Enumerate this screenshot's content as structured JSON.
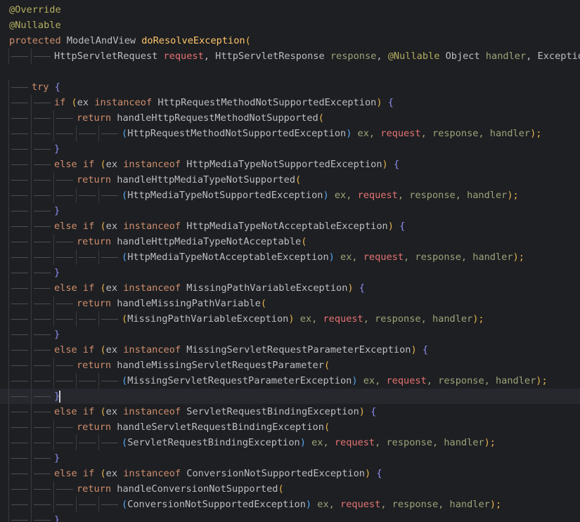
{
  "colors": {
    "background": "#1e1f22",
    "current_line": "#26282e",
    "annotation": "#b3ae60",
    "keyword": "#cf8e6d",
    "method_declaration": "#ffc66d",
    "type": "#bcbec4"
  },
  "editor": {
    "lines": [
      {
        "indent": 0,
        "tokens": [
          {
            "t": "@Override",
            "c": "t-ann"
          }
        ]
      },
      {
        "indent": 0,
        "tokens": [
          {
            "t": "@Nullable",
            "c": "t-ann"
          }
        ]
      },
      {
        "indent": 0,
        "tokens": [
          {
            "t": "protected",
            "c": "t-kw"
          },
          {
            "t": " ModelAndView ",
            "c": "t-ty"
          },
          {
            "t": "doResolveException",
            "c": "t-fnd"
          },
          {
            "t": "(",
            "c": "t-brace1"
          }
        ]
      },
      {
        "indent": 2,
        "tokens": [
          {
            "t": "HttpServletRequest ",
            "c": "t-ty"
          },
          {
            "t": "request",
            "c": "t-argp"
          },
          {
            "t": ", ",
            "c": "t-punc"
          },
          {
            "t": "HttpServletResponse ",
            "c": "t-ty"
          },
          {
            "t": "response",
            "c": "t-argr"
          },
          {
            "t": ", ",
            "c": "t-punc"
          },
          {
            "t": "@Nullable",
            "c": "t-ann"
          },
          {
            "t": " Object ",
            "c": "t-ty"
          },
          {
            "t": "handler",
            "c": "t-argr"
          },
          {
            "t": ", ",
            "c": "t-punc"
          },
          {
            "t": "Exception ex",
            "c": "t-ty"
          }
        ]
      },
      {
        "indent": 0,
        "tokens": []
      },
      {
        "indent": 1,
        "tokens": [
          {
            "t": "try",
            "c": "t-kw"
          },
          {
            "t": " {",
            "c": "t-brace2"
          }
        ]
      },
      {
        "indent": 2,
        "tokens": [
          {
            "t": "if",
            "c": "t-kw"
          },
          {
            "t": " (",
            "c": "t-brace1"
          },
          {
            "t": "ex ",
            "c": "t-local"
          },
          {
            "t": "instanceof",
            "c": "t-kw"
          },
          {
            "t": " HttpRequestMethodNotSupportedException",
            "c": "t-ty"
          },
          {
            "t": ")",
            "c": "t-brace1"
          },
          {
            "t": " {",
            "c": "t-brace2"
          }
        ]
      },
      {
        "indent": 3,
        "tokens": [
          {
            "t": "return",
            "c": "t-kw"
          },
          {
            "t": " handleHttpRequestMethodNotSupported",
            "c": "t-ty"
          },
          {
            "t": "(",
            "c": "t-brace1"
          }
        ]
      },
      {
        "indent": 5,
        "tokens": [
          {
            "t": "(",
            "c": "t-brace3"
          },
          {
            "t": "HttpRequestMethodNotSupportedException",
            "c": "t-ty"
          },
          {
            "t": ")",
            "c": "t-brace3"
          },
          {
            "t": " ex, ",
            "c": "t-argr"
          },
          {
            "t": "request",
            "c": "t-argp"
          },
          {
            "t": ", response, handler",
            "c": "t-argr"
          },
          {
            "t": ");",
            "c": "t-brace1"
          }
        ]
      },
      {
        "indent": 2,
        "tokens": [
          {
            "t": "}",
            "c": "t-brace2"
          }
        ]
      },
      {
        "indent": 2,
        "tokens": [
          {
            "t": "else if",
            "c": "t-kw"
          },
          {
            "t": " (",
            "c": "t-brace1"
          },
          {
            "t": "ex ",
            "c": "t-local"
          },
          {
            "t": "instanceof",
            "c": "t-kw"
          },
          {
            "t": " HttpMediaTypeNotSupportedException",
            "c": "t-ty"
          },
          {
            "t": ")",
            "c": "t-brace1"
          },
          {
            "t": " {",
            "c": "t-brace2"
          }
        ]
      },
      {
        "indent": 3,
        "tokens": [
          {
            "t": "return",
            "c": "t-kw"
          },
          {
            "t": " handleHttpMediaTypeNotSupported",
            "c": "t-ty"
          },
          {
            "t": "(",
            "c": "t-brace1"
          }
        ]
      },
      {
        "indent": 5,
        "tokens": [
          {
            "t": "(",
            "c": "t-brace3"
          },
          {
            "t": "HttpMediaTypeNotSupportedException",
            "c": "t-ty"
          },
          {
            "t": ")",
            "c": "t-brace3"
          },
          {
            "t": " ex, ",
            "c": "t-argr"
          },
          {
            "t": "request",
            "c": "t-argp"
          },
          {
            "t": ", response, handler",
            "c": "t-argr"
          },
          {
            "t": ");",
            "c": "t-brace1"
          }
        ]
      },
      {
        "indent": 2,
        "tokens": [
          {
            "t": "}",
            "c": "t-brace2"
          }
        ]
      },
      {
        "indent": 2,
        "tokens": [
          {
            "t": "else if",
            "c": "t-kw"
          },
          {
            "t": " (",
            "c": "t-brace1"
          },
          {
            "t": "ex ",
            "c": "t-local"
          },
          {
            "t": "instanceof",
            "c": "t-kw"
          },
          {
            "t": " HttpMediaTypeNotAcceptableException",
            "c": "t-ty"
          },
          {
            "t": ")",
            "c": "t-brace1"
          },
          {
            "t": " {",
            "c": "t-brace2"
          }
        ]
      },
      {
        "indent": 3,
        "tokens": [
          {
            "t": "return",
            "c": "t-kw"
          },
          {
            "t": " handleHttpMediaTypeNotAcceptable",
            "c": "t-ty"
          },
          {
            "t": "(",
            "c": "t-brace1"
          }
        ]
      },
      {
        "indent": 5,
        "tokens": [
          {
            "t": "(",
            "c": "t-brace3"
          },
          {
            "t": "HttpMediaTypeNotAcceptableException",
            "c": "t-ty"
          },
          {
            "t": ")",
            "c": "t-brace3"
          },
          {
            "t": " ex, ",
            "c": "t-argr"
          },
          {
            "t": "request",
            "c": "t-argp"
          },
          {
            "t": ", response, handler",
            "c": "t-argr"
          },
          {
            "t": ");",
            "c": "t-brace1"
          }
        ]
      },
      {
        "indent": 2,
        "tokens": [
          {
            "t": "}",
            "c": "t-brace2"
          }
        ]
      },
      {
        "indent": 2,
        "tokens": [
          {
            "t": "else if",
            "c": "t-kw"
          },
          {
            "t": " (",
            "c": "t-brace1"
          },
          {
            "t": "ex ",
            "c": "t-local"
          },
          {
            "t": "instanceof",
            "c": "t-kw"
          },
          {
            "t": " MissingPathVariableException",
            "c": "t-ty"
          },
          {
            "t": ")",
            "c": "t-brace1"
          },
          {
            "t": " {",
            "c": "t-brace2"
          }
        ]
      },
      {
        "indent": 3,
        "tokens": [
          {
            "t": "return",
            "c": "t-kw"
          },
          {
            "t": " handleMissingPathVariable",
            "c": "t-ty"
          },
          {
            "t": "(",
            "c": "t-brace1"
          }
        ]
      },
      {
        "indent": 5,
        "tokens": [
          {
            "t": "(",
            "c": "t-brace1"
          },
          {
            "t": "MissingPathVariableException",
            "c": "t-ty"
          },
          {
            "t": ")",
            "c": "t-brace1"
          },
          {
            "t": " ex, ",
            "c": "t-argr"
          },
          {
            "t": "request",
            "c": "t-argp"
          },
          {
            "t": ", response, handler",
            "c": "t-argr"
          },
          {
            "t": ");",
            "c": "t-brace1"
          }
        ]
      },
      {
        "indent": 2,
        "tokens": [
          {
            "t": "}",
            "c": "t-brace2"
          }
        ]
      },
      {
        "indent": 2,
        "tokens": [
          {
            "t": "else if",
            "c": "t-kw"
          },
          {
            "t": " (",
            "c": "t-brace1"
          },
          {
            "t": "ex ",
            "c": "t-local"
          },
          {
            "t": "instanceof",
            "c": "t-kw"
          },
          {
            "t": " MissingServletRequestParameterException",
            "c": "t-ty"
          },
          {
            "t": ")",
            "c": "t-brace1"
          },
          {
            "t": " {",
            "c": "t-brace2"
          }
        ]
      },
      {
        "indent": 3,
        "tokens": [
          {
            "t": "return",
            "c": "t-kw"
          },
          {
            "t": " handleMissingServletRequestParameter",
            "c": "t-ty"
          },
          {
            "t": "(",
            "c": "t-brace1"
          }
        ]
      },
      {
        "indent": 5,
        "tokens": [
          {
            "t": "(",
            "c": "t-brace3"
          },
          {
            "t": "MissingServletRequestParameterException",
            "c": "t-ty"
          },
          {
            "t": ")",
            "c": "t-brace3"
          },
          {
            "t": " ex, ",
            "c": "t-argr"
          },
          {
            "t": "request",
            "c": "t-argp"
          },
          {
            "t": ", response, handler",
            "c": "t-argr"
          },
          {
            "t": ");",
            "c": "t-brace1"
          }
        ]
      },
      {
        "indent": 2,
        "current": true,
        "tokens": [
          {
            "t": "}",
            "c": "t-brace2"
          }
        ]
      },
      {
        "indent": 2,
        "tokens": [
          {
            "t": "else if",
            "c": "t-kw"
          },
          {
            "t": " (",
            "c": "t-brace1"
          },
          {
            "t": "ex ",
            "c": "t-local"
          },
          {
            "t": "instanceof",
            "c": "t-kw"
          },
          {
            "t": " ServletRequestBindingException",
            "c": "t-ty"
          },
          {
            "t": ")",
            "c": "t-brace1"
          },
          {
            "t": " {",
            "c": "t-brace2"
          }
        ]
      },
      {
        "indent": 3,
        "tokens": [
          {
            "t": "return",
            "c": "t-kw"
          },
          {
            "t": " handleServletRequestBindingException",
            "c": "t-ty"
          },
          {
            "t": "(",
            "c": "t-brace1"
          }
        ]
      },
      {
        "indent": 5,
        "tokens": [
          {
            "t": "(",
            "c": "t-brace3"
          },
          {
            "t": "ServletRequestBindingException",
            "c": "t-ty"
          },
          {
            "t": ")",
            "c": "t-brace3"
          },
          {
            "t": " ex, ",
            "c": "t-argr"
          },
          {
            "t": "request",
            "c": "t-argp"
          },
          {
            "t": ", response, handler",
            "c": "t-argr"
          },
          {
            "t": ");",
            "c": "t-brace1"
          }
        ]
      },
      {
        "indent": 2,
        "tokens": [
          {
            "t": "}",
            "c": "t-brace2"
          }
        ]
      },
      {
        "indent": 2,
        "tokens": [
          {
            "t": "else if",
            "c": "t-kw"
          },
          {
            "t": " (",
            "c": "t-brace1"
          },
          {
            "t": "ex ",
            "c": "t-local"
          },
          {
            "t": "instanceof",
            "c": "t-kw"
          },
          {
            "t": " ConversionNotSupportedException",
            "c": "t-ty"
          },
          {
            "t": ")",
            "c": "t-brace1"
          },
          {
            "t": " {",
            "c": "t-brace2"
          }
        ]
      },
      {
        "indent": 3,
        "tokens": [
          {
            "t": "return",
            "c": "t-kw"
          },
          {
            "t": " handleConversionNotSupported",
            "c": "t-ty"
          },
          {
            "t": "(",
            "c": "t-brace1"
          }
        ]
      },
      {
        "indent": 5,
        "tokens": [
          {
            "t": "(",
            "c": "t-brace3"
          },
          {
            "t": "ConversionNotSupportedException",
            "c": "t-ty"
          },
          {
            "t": ")",
            "c": "t-brace3"
          },
          {
            "t": " ex, ",
            "c": "t-argr"
          },
          {
            "t": "request",
            "c": "t-argp"
          },
          {
            "t": ", response, handler",
            "c": "t-argr"
          },
          {
            "t": ");",
            "c": "t-brace1"
          }
        ]
      },
      {
        "indent": 2,
        "tokens": [
          {
            "t": "}",
            "c": "t-brace2"
          }
        ]
      }
    ]
  }
}
